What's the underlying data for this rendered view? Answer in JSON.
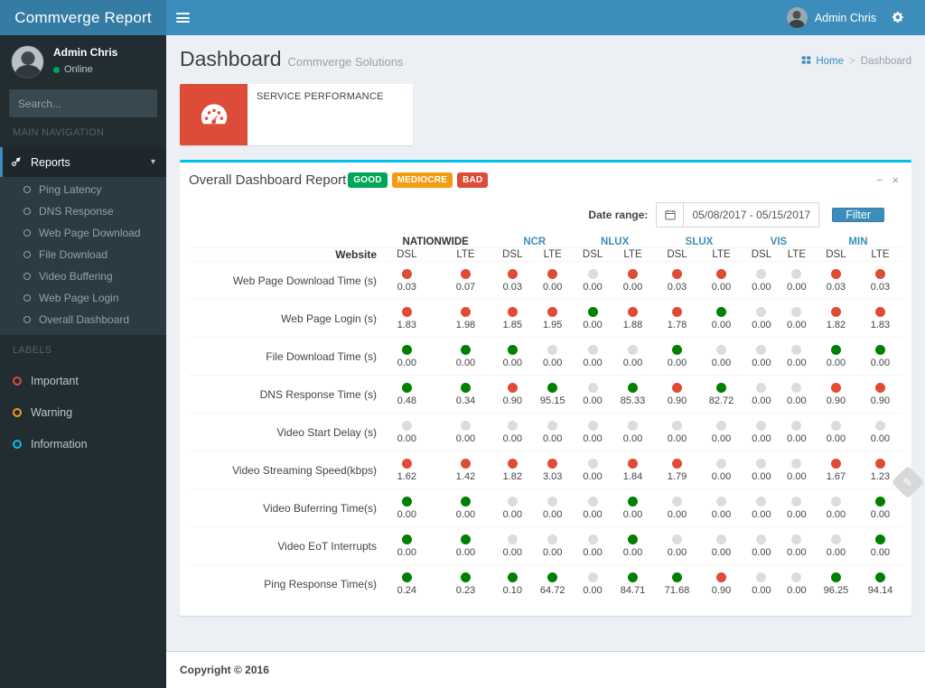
{
  "app": {
    "logo_title": "Commverge Report",
    "menu_icon": "hamburger-icon"
  },
  "navbar": {
    "user_name": "Admin Chris",
    "gear_icon": "gear-icon"
  },
  "sidebar": {
    "user_name": "Admin Chris",
    "user_status": "Online",
    "search_placeholder": "Search...",
    "search_value": "",
    "search_icon": "search-icon",
    "nav_header": "MAIN NAVIGATION",
    "reports": {
      "label": "Reports",
      "icon": "link-icon",
      "chevron": "chevron-down-icon"
    },
    "reports_items": [
      {
        "label": "Ping Latency"
      },
      {
        "label": "DNS Response"
      },
      {
        "label": " Web Page Download"
      },
      {
        "label": "File Download"
      },
      {
        "label": "Video Buffering"
      },
      {
        "label": "Web Page Login"
      },
      {
        "label": "Overall Dashboard"
      }
    ],
    "labels_header": "LABELS",
    "labels": [
      {
        "label": "Important",
        "color": "#dd4b39"
      },
      {
        "label": "Warning",
        "color": "#f39c12"
      },
      {
        "label": "Information",
        "color": "#00c0ef"
      }
    ]
  },
  "page": {
    "title": "Dashboard",
    "subtitle": "Commverge Solutions",
    "breadcrumb": [
      {
        "label": "Home",
        "icon": "dashboard-icon",
        "link": true
      },
      {
        "label": "Dashboard",
        "link": false
      }
    ],
    "breadcrumb_separator": ">"
  },
  "infobox": {
    "icon": "speedometer-icon",
    "text": "SERVICE PERFORMANCE",
    "color": "#dd4b39"
  },
  "box": {
    "title": "Overall Dashboard Report",
    "badges": [
      {
        "label": "GOOD",
        "color": "#00a65a"
      },
      {
        "label": "MEDIOCRE",
        "color": "#f39c12"
      },
      {
        "label": "BAD",
        "color": "#dd4b39"
      }
    ],
    "tools": [
      {
        "name": "minimize-icon",
        "glyph": "−"
      },
      {
        "name": "close-icon",
        "glyph": "×"
      }
    ],
    "accent_color": "#00c0ef"
  },
  "filters": {
    "date_label": "Date range:",
    "calendar_icon": "calendar-icon",
    "date_value": "05/08/2017 - 05/15/2017",
    "filter_button": "Filter"
  },
  "chart_data": {
    "type": "table",
    "title": "Overall Dashboard Report",
    "row_header": "Website",
    "regions": [
      "NATIONWIDE",
      "NCR",
      "NLUX",
      "SLUX",
      "VIS",
      "MIN"
    ],
    "technologies": [
      "DSL",
      "LTE"
    ],
    "columns": [
      "NATIONWIDE DSL",
      "NATIONWIDE LTE",
      "NCR DSL",
      "NCR LTE",
      "NLUX DSL",
      "NLUX LTE",
      "SLUX DSL",
      "SLUX LTE",
      "VIS DSL",
      "VIS LTE",
      "MIN DSL",
      "MIN LTE"
    ],
    "status_colors": {
      "red": "#e04b35",
      "green": "#008000",
      "gray": "#dcdcdc"
    },
    "rows": [
      {
        "label": "Web Page Download Time (s)",
        "values": [
          "0.03",
          "0.07",
          "0.03",
          "0.00",
          "0.00",
          "0.00",
          "0.03",
          "0.00",
          "0.00",
          "0.00",
          "0.03",
          "0.03"
        ],
        "status": [
          "red",
          "red",
          "red",
          "red",
          "gray",
          "red",
          "red",
          "red",
          "gray",
          "gray",
          "red",
          "red"
        ]
      },
      {
        "label": "Web Page Login (s)",
        "values": [
          "1.83",
          "1.98",
          "1.85",
          "1.95",
          "0.00",
          "1.88",
          "1.78",
          "0.00",
          "0.00",
          "0.00",
          "1.82",
          "1.83"
        ],
        "status": [
          "red",
          "red",
          "red",
          "red",
          "green",
          "red",
          "red",
          "green",
          "gray",
          "gray",
          "red",
          "red"
        ]
      },
      {
        "label": "File Download Time (s)",
        "values": [
          "0.00",
          "0.00",
          "0.00",
          "0.00",
          "0.00",
          "0.00",
          "0.00",
          "0.00",
          "0.00",
          "0.00",
          "0.00",
          "0.00"
        ],
        "status": [
          "green",
          "green",
          "green",
          "gray",
          "gray",
          "gray",
          "green",
          "gray",
          "gray",
          "gray",
          "green",
          "green"
        ]
      },
      {
        "label": "DNS Response Time (s)",
        "values": [
          "0.48",
          "0.34",
          "0.90",
          "95.15",
          "0.00",
          "85.33",
          "0.90",
          "82.72",
          "0.00",
          "0.00",
          "0.90",
          "0.90"
        ],
        "status": [
          "green",
          "green",
          "red",
          "green",
          "gray",
          "green",
          "red",
          "green",
          "gray",
          "gray",
          "red",
          "red"
        ]
      },
      {
        "label": "Video Start Delay (s)",
        "values": [
          "0.00",
          "0.00",
          "0.00",
          "0.00",
          "0.00",
          "0.00",
          "0.00",
          "0.00",
          "0.00",
          "0.00",
          "0.00",
          "0.00"
        ],
        "status": [
          "gray",
          "gray",
          "gray",
          "gray",
          "gray",
          "gray",
          "gray",
          "gray",
          "gray",
          "gray",
          "gray",
          "gray"
        ]
      },
      {
        "label": "Video Streaming Speed(kbps)",
        "values": [
          "1.62",
          "1.42",
          "1.82",
          "3.03",
          "0.00",
          "1.84",
          "1.79",
          "0.00",
          "0.00",
          "0.00",
          "1.67",
          "1.23"
        ],
        "status": [
          "red",
          "red",
          "red",
          "red",
          "gray",
          "red",
          "red",
          "gray",
          "gray",
          "gray",
          "red",
          "red"
        ]
      },
      {
        "label": "Video Buferring Time(s)",
        "values": [
          "0.00",
          "0.00",
          "0.00",
          "0.00",
          "0.00",
          "0.00",
          "0.00",
          "0.00",
          "0.00",
          "0.00",
          "0.00",
          "0.00"
        ],
        "status": [
          "green",
          "green",
          "gray",
          "gray",
          "gray",
          "green",
          "gray",
          "gray",
          "gray",
          "gray",
          "gray",
          "green"
        ]
      },
      {
        "label": "Video EoT Interrupts",
        "values": [
          "0.00",
          "0.00",
          "0.00",
          "0.00",
          "0.00",
          "0.00",
          "0.00",
          "0.00",
          "0.00",
          "0.00",
          "0.00",
          "0.00"
        ],
        "status": [
          "green",
          "green",
          "gray",
          "gray",
          "gray",
          "green",
          "gray",
          "gray",
          "gray",
          "gray",
          "gray",
          "green"
        ]
      },
      {
        "label": "Ping Response Time(s)",
        "values": [
          "0.24",
          "0.23",
          "0.10",
          "64.72",
          "0.00",
          "84.71",
          "71.68",
          "0.90",
          "0.00",
          "0.00",
          "96.25",
          "94.14"
        ],
        "status": [
          "green",
          "green",
          "green",
          "green",
          "gray",
          "green",
          "green",
          "red",
          "gray",
          "gray",
          "green",
          "green"
        ]
      }
    ]
  },
  "ribbon": {
    "icon": "feedback-tab-icon"
  },
  "footer": {
    "copyright": "Copyright © 2016"
  }
}
